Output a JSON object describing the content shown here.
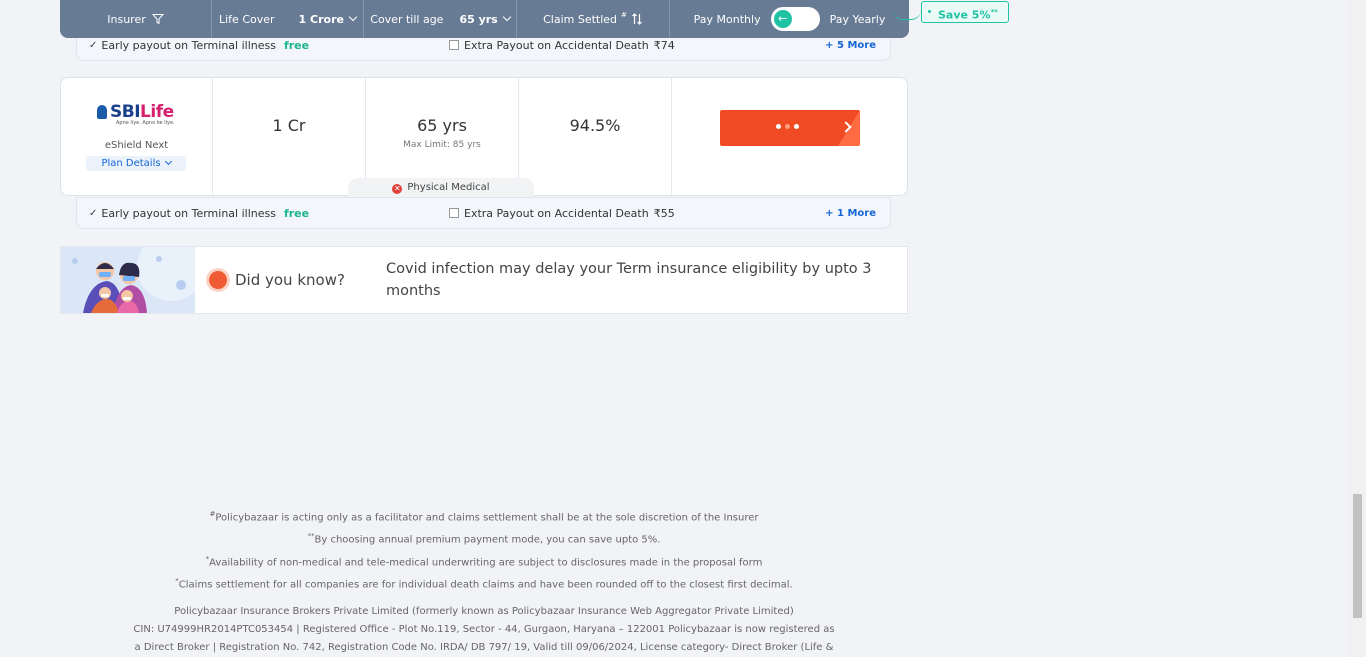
{
  "filters": {
    "insurer_label": "Insurer",
    "life_cover_label": "Life Cover",
    "life_cover_value": "1 Crore",
    "cover_age_label": "Cover till age",
    "cover_age_value": "65 yrs",
    "claim_label": "Claim Settled",
    "claim_marker": "#",
    "pay_monthly": "Pay Monthly",
    "pay_yearly": "Pay Yearly",
    "toggle_icon": "←",
    "save_badge": "Save 5%",
    "save_marker": "**"
  },
  "prev_plan_strip": {
    "feature1": "Early payout on Terminal illness",
    "feature1_tag": "free",
    "feature2": "Extra Payout on Accidental Death",
    "feature2_price": "₹74",
    "more": "+ 5 More"
  },
  "plan": {
    "logo_primary": "SBI",
    "logo_secondary": "Life",
    "tagline": "Apne liye. Apno ke liye.",
    "name": "eShield Next",
    "details_link": "Plan Details",
    "cover": "1 Cr",
    "cover_till": "65 yrs",
    "max_limit": "Max Limit: 85 yrs",
    "claim_settled": "94.5%",
    "medical": "Physical Medical",
    "strip": {
      "feature1": "Early payout on Terminal illness",
      "feature1_tag": "free",
      "feature2": "Extra Payout on Accidental Death",
      "feature2_price": "₹55",
      "more": "+ 1 More"
    }
  },
  "did_you_know": {
    "label": "Did you know?",
    "text": "Covid infection may delay your Term insurance eligibility by upto 3 months"
  },
  "footer": {
    "note1_marker": "#",
    "note1": "Policybazaar is acting only as a facilitator and claims settlement shall be at the sole discretion of the Insurer",
    "note2_marker": "**",
    "note2": "By choosing annual premium payment mode, you can save upto 5%.",
    "note3_marker": "*",
    "note3": "Availability of non-medical and tele-medical underwriting are subject to disclosures made in the proposal form",
    "note4_marker": "*",
    "note4": "Claims settlement for all companies are for individual death claims and have been rounded off to the closest first decimal.",
    "company1": "Policybazaar Insurance Brokers Private Limited (formerly known as Policybazaar Insurance Web Aggregator Private Limited)",
    "company2": "CIN: U74999HR2014PTC053454 | Registered Office - Plot No.119, Sector - 44, Gurgaon, Haryana – 122001 Policybazaar is now registered as",
    "company3": "a Direct Broker | Registration No. 742, Registration Code No. IRDA/ DB 797/ 19, Valid till 09/06/2024, License category- Direct Broker (Life &"
  },
  "colors": {
    "topbar": "#687b94",
    "accent_green": "#1fc3a4",
    "cta_orange": "#f04b23",
    "link_blue": "#1666d6"
  }
}
